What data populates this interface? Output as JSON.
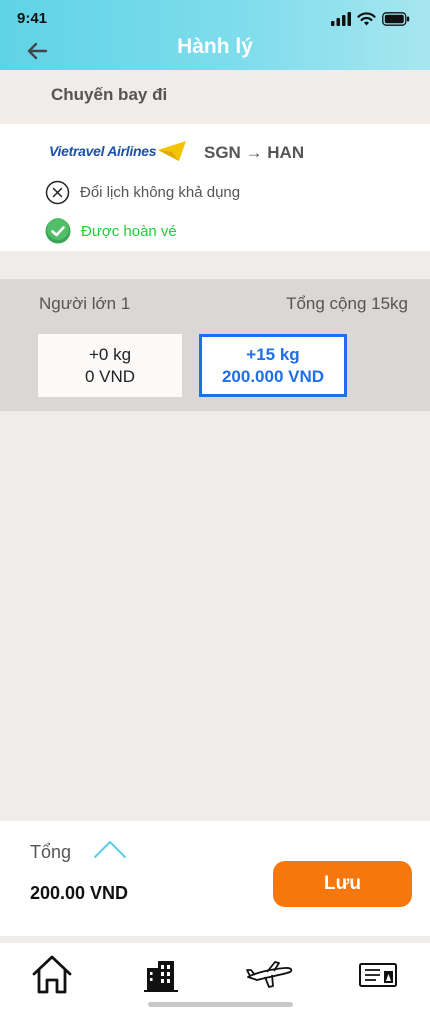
{
  "status_bar": {
    "time": "9:41"
  },
  "header": {
    "title": "Hành lý"
  },
  "section": {
    "title": "Chuyến bay đi"
  },
  "flight": {
    "airline": "Vietravel Airlines",
    "route": "SGN → HAN",
    "reschedule_policy": "Đổi lịch không khả dụng",
    "refund_policy": "Được hoàn vé"
  },
  "baggage": {
    "passenger_label": "Người lớn 1",
    "total_label": "Tổng cộng 15kg",
    "options": [
      {
        "weight": "+0 kg",
        "price": "0 VND",
        "selected": false
      },
      {
        "weight": "+15 kg",
        "price": "200.000 VND",
        "selected": true
      }
    ]
  },
  "summary": {
    "label": "Tổng",
    "total": "200.00 VND",
    "save_label": "Lưu"
  },
  "tabs": [
    {
      "icon": "home-icon"
    },
    {
      "icon": "hotel-icon"
    },
    {
      "icon": "airplane-icon"
    },
    {
      "icon": "ticket-icon"
    }
  ],
  "colors": {
    "header_start": "#5fd3e6",
    "accent_blue": "#1e6fe8",
    "save_orange": "#f7770f",
    "refund_green": "#1fcf3a",
    "airline_blue": "#1a52a8",
    "airline_yellow": "#f5c400"
  }
}
